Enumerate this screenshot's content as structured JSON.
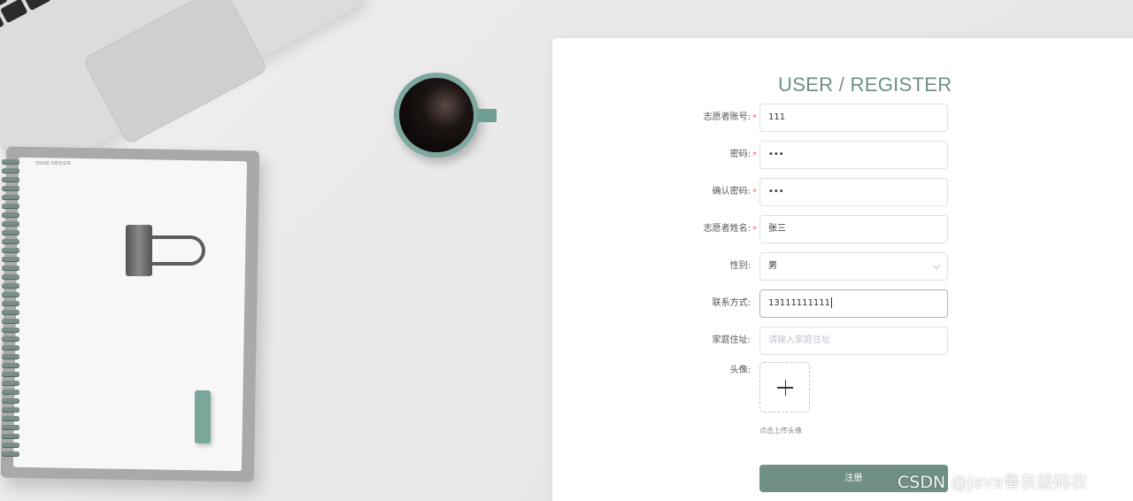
{
  "page": {
    "title": "USER / REGISTER",
    "accent_color": "#6f8f87"
  },
  "form": {
    "fields": [
      {
        "label": "志愿者账号:",
        "required": true,
        "value": "111",
        "type": "text"
      },
      {
        "label": "密码:",
        "required": true,
        "value": "•••",
        "type": "password"
      },
      {
        "label": "确认密码:",
        "required": true,
        "value": "•••",
        "type": "password"
      },
      {
        "label": "志愿者姓名:",
        "required": true,
        "value": "张三",
        "type": "text"
      },
      {
        "label": "性别:",
        "required": false,
        "value": "男",
        "type": "select"
      },
      {
        "label": "联系方式:",
        "required": false,
        "value": "13111111111",
        "type": "text"
      },
      {
        "label": "家庭住址:",
        "required": false,
        "value": "",
        "placeholder": "请输入家庭住址",
        "type": "text"
      }
    ],
    "avatar": {
      "label": "头像:",
      "icon": "plus-icon",
      "tip": "点击上传头像"
    },
    "submit_label": "注册"
  },
  "scene": {
    "notebook_label": "YOUR DESIGN"
  },
  "watermark": "CSDN @Java骨灰级码农"
}
